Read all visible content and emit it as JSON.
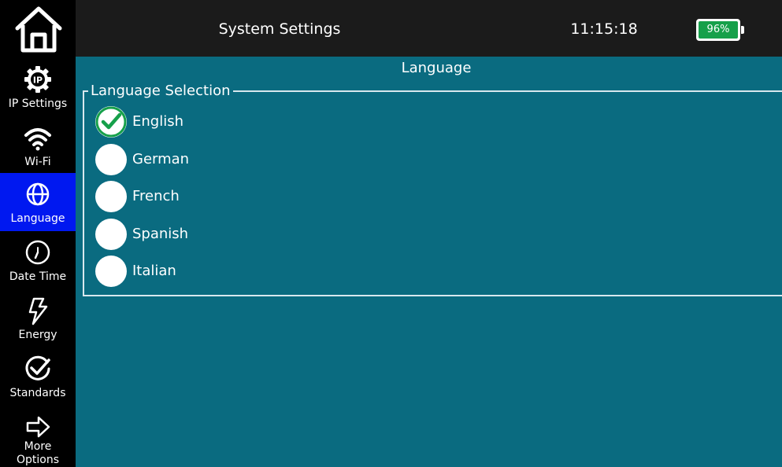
{
  "header": {
    "title": "System Settings",
    "time": "11:15:18",
    "battery": "96%",
    "battery_level": 0.96,
    "home_icon": "home-icon"
  },
  "sidebar": {
    "items": [
      {
        "label": "IP Settings",
        "icon": "ip-gear-icon",
        "active": false
      },
      {
        "label": "Wi-Fi",
        "icon": "wifi-icon",
        "active": false
      },
      {
        "label": "Language",
        "icon": "globe-icon",
        "active": true
      },
      {
        "label": "Date Time",
        "icon": "clock-icon",
        "active": false
      },
      {
        "label": "Energy",
        "icon": "lightning-icon",
        "active": false
      },
      {
        "label": "Standards",
        "icon": "check-circle-icon",
        "active": false
      },
      {
        "label_line1": "More",
        "label_line2": "Options",
        "icon": "arrow-right-icon",
        "active": false
      }
    ]
  },
  "main": {
    "heading": "Language",
    "group_label": "Language Selection",
    "options": [
      {
        "label": "English",
        "selected": true
      },
      {
        "label": "German",
        "selected": false
      },
      {
        "label": "French",
        "selected": false
      },
      {
        "label": "Spanish",
        "selected": false
      },
      {
        "label": "Italian",
        "selected": false
      }
    ]
  },
  "colors": {
    "content_bg": "#0a6b80",
    "active_nav": "#0018f0",
    "battery_fill": "#16a04a",
    "check": "#16a04a"
  }
}
